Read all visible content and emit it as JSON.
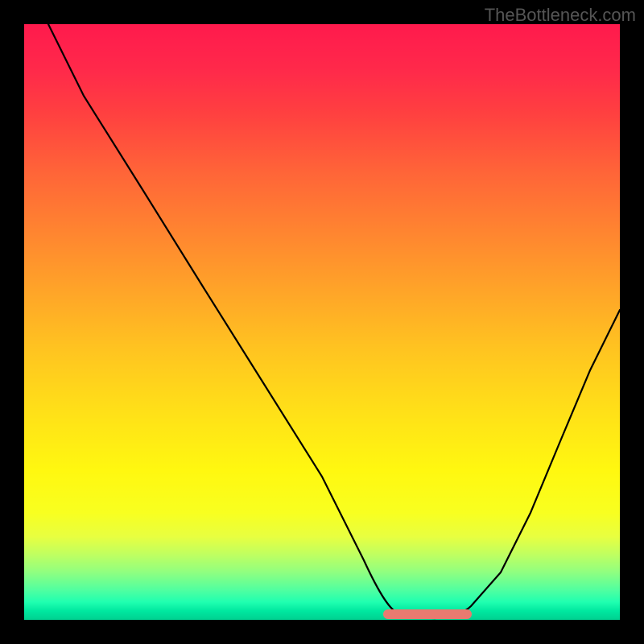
{
  "watermark": "TheBottleneck.com",
  "chart_data": {
    "type": "line",
    "title": "",
    "xlabel": "",
    "ylabel": "",
    "xlim": [
      0,
      100
    ],
    "ylim": [
      0,
      100
    ],
    "series": [
      {
        "name": "curve",
        "x": [
          4,
          10,
          20,
          30,
          40,
          50,
          57,
          60,
          63,
          66,
          70,
          75,
          80,
          85,
          90,
          95,
          100
        ],
        "y": [
          100,
          88,
          72,
          56,
          40,
          24,
          10,
          4,
          1,
          0,
          0,
          2,
          8,
          18,
          30,
          42,
          52
        ]
      }
    ],
    "highlight_band": {
      "x_start": 60,
      "x_end": 75,
      "y": 0
    },
    "background_gradient": {
      "top": "#ff1a4d",
      "middle": "#ffe018",
      "bottom": "#00d090"
    }
  }
}
